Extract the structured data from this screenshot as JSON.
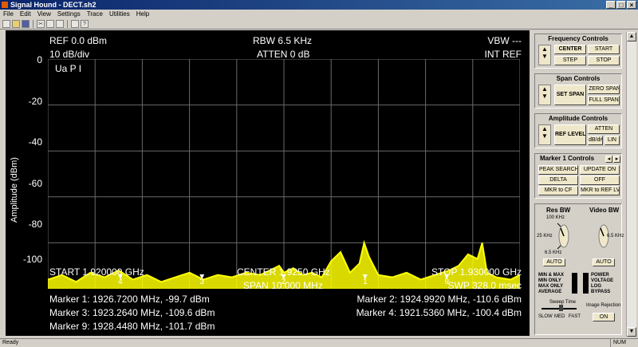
{
  "window": {
    "title": "Signal Hound - DECT.sh2"
  },
  "menu": [
    "File",
    "Edit",
    "View",
    "Settings",
    "Trace",
    "Utilities",
    "Help"
  ],
  "display": {
    "ref": "REF 0.0 dBm",
    "div": "10 dB/div",
    "rbw": "RBW 6.5 KHz",
    "atten": "ATTEN 0 dB",
    "vbw": "VBW ---",
    "intref": "INT REF",
    "trace_label": "Ua P I",
    "ylabel": "Amplitude (dBm)",
    "start": "START 1.920000 GHz",
    "center": "CENTER 1.9250 GHz",
    "stop": "STOP 1.930000 GHz",
    "span": "SPAN 10.000 MHz",
    "swp": "SWP 328.0 msec",
    "markers_left": [
      "Marker 1: 1926.7200 MHz, -99.7 dBm",
      "Marker 3: 1923.2640 MHz, -109.6 dBm",
      "Marker 9: 1928.4480 MHz, -101.7 dBm"
    ],
    "markers_right": [
      "Marker 2: 1924.9920 MHz, -110.6 dBm",
      "Marker 4: 1921.5360 MHz, -100.4 dBm"
    ]
  },
  "chart_data": {
    "type": "line",
    "xlabel": "",
    "ylabel": "Amplitude (dBm)",
    "xlim": [
      1.92,
      1.93
    ],
    "ylim": [
      -100,
      0
    ],
    "yticks": [
      "0",
      "-20",
      "-40",
      "-60",
      "-80",
      "-100"
    ],
    "grid": true,
    "series": [
      {
        "color": "#ffff00",
        "x": [
          1.92,
          1.9203,
          1.9206,
          1.9209,
          1.9212,
          1.9215,
          1.9218,
          1.9221,
          1.9224,
          1.9227,
          1.923,
          1.9233,
          1.9236,
          1.9239,
          1.9242,
          1.9245,
          1.9247,
          1.9249,
          1.925,
          1.9252,
          1.9254,
          1.9256,
          1.9258,
          1.926,
          1.9262,
          1.9264,
          1.9266,
          1.9267,
          1.9268,
          1.927,
          1.9273,
          1.9276,
          1.9279,
          1.9282,
          1.9285,
          1.9287,
          1.9289,
          1.9291,
          1.9292,
          1.9293,
          1.9295,
          1.9298,
          1.93
        ],
        "y": [
          -96,
          -94,
          -97,
          -93,
          -95,
          -92,
          -96,
          -94,
          -97,
          -95,
          -93,
          -96,
          -94,
          -95,
          -93,
          -94,
          -92,
          -90,
          -93,
          -91,
          -94,
          -93,
          -95,
          -88,
          -84,
          -93,
          -89,
          -80,
          -86,
          -94,
          -95,
          -93,
          -96,
          -94,
          -92,
          -90,
          -85,
          -87,
          -80,
          -93,
          -95,
          -96,
          -94
        ]
      }
    ],
    "markers": [
      {
        "label": "1",
        "x": 1.92672,
        "y": -99.7
      },
      {
        "label": "2",
        "x": 1.924992,
        "y": -110.6
      },
      {
        "label": "3",
        "x": 1.923264,
        "y": -109.6
      },
      {
        "label": "4",
        "x": 1.921536,
        "y": -100.4
      },
      {
        "label": "9",
        "x": 1.928448,
        "y": -101.7
      }
    ]
  },
  "panel": {
    "freq": {
      "title": "Frequency Controls",
      "center": "CENTER",
      "start": "START",
      "step": "STEP",
      "stop": "STOP"
    },
    "span": {
      "title": "Span Controls",
      "set": "SET SPAN",
      "zero": "ZERO SPAN",
      "full": "FULL SPAN"
    },
    "amp": {
      "title": "Amplitude Controls",
      "ref": "REF LEVEL",
      "atten": "ATTEN",
      "dbdiv": "dB/div",
      "lin": "LIN"
    },
    "marker": {
      "title": "Marker 1 Controls",
      "peak": "PEAK SEARCH",
      "update": "UPDATE ON",
      "delta": "DELTA",
      "off": "OFF",
      "mkrcf": "MKR to CF",
      "mkrref": "MKR to REF LVL"
    },
    "bw": {
      "res": "Res BW",
      "video": "Video BW",
      "r100": "100 KHz",
      "r25": "25 KHz",
      "r65": "6.5 KHz",
      "v65": "6.5 KHz",
      "auto1": "AUTO",
      "auto2": "AUTO",
      "detect": [
        "MIN & MAX",
        "MIN ONLY",
        "MAX ONLY",
        "AVERAGE"
      ],
      "proc": [
        "POWER",
        "VOLTAGE",
        "LOG",
        "BYPASS"
      ],
      "sweep": "Sweep Time",
      "slow": "SLOW",
      "med": "MED",
      "fast": "FAST",
      "image": "Image Rejection",
      "on": "ON"
    }
  },
  "status": {
    "text": "Ready",
    "num": "NUM"
  }
}
